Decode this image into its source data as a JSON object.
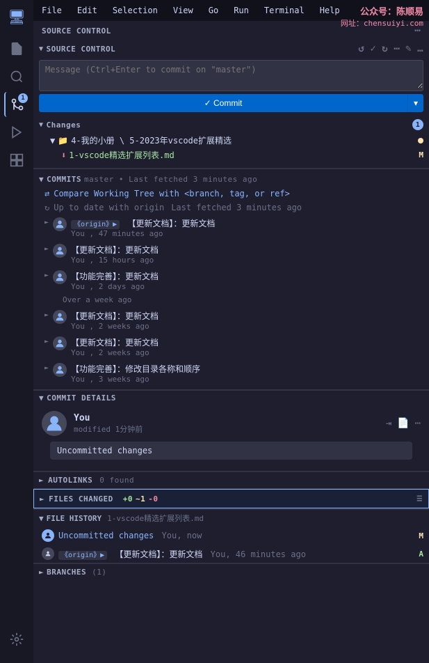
{
  "titlebar": {
    "menu_items": [
      "File",
      "Edit",
      "Selection",
      "View",
      "Go",
      "Run",
      "Terminal",
      "Help"
    ]
  },
  "watermark": {
    "line1": "公众号：陈顺易",
    "line2": "网址：chensuiyi.com"
  },
  "activity_bar": {
    "icons": [
      {
        "name": "explorer-icon",
        "symbol": "📄",
        "active": false
      },
      {
        "name": "search-icon",
        "symbol": "🔍",
        "active": false
      },
      {
        "name": "source-control-icon",
        "symbol": "⎇",
        "active": true,
        "badge": "1"
      },
      {
        "name": "run-icon",
        "symbol": "▶",
        "active": false
      },
      {
        "name": "extensions-icon",
        "symbol": "⊞",
        "active": false
      },
      {
        "name": "git-icon",
        "symbol": "🌿",
        "active": false
      }
    ]
  },
  "source_control": {
    "panel_header": "SOURCE CONTROL",
    "section_title": "SOURCE CONTROL",
    "message_placeholder": "Message (Ctrl+Enter to commit on \"master\")",
    "commit_button": "✓ Commit",
    "commit_dropdown_label": "▾",
    "changes": {
      "label": "Changes",
      "badge": "1",
      "folder": "4-我的小册 \\ 5-2023年vscode扩展精选",
      "file": "1-vscode精选扩展列表.md",
      "file_badge": "M"
    },
    "commits": {
      "header": "COMMITS",
      "subtitle": "master • Last fetched 3 minutes ago",
      "compare_action": "Compare Working Tree with <branch, tag, or ref>",
      "up_to_date": "Up to date with origin",
      "up_to_date_meta": "Last fetched 3 minutes ago",
      "items": [
        {
          "origin_tag": "《origin》▶",
          "message": "【更新文档】：更新文档",
          "author": "You",
          "time": "47 minutes ago",
          "has_origin": true
        },
        {
          "message": "【更新文档】：更新文档",
          "author": "You",
          "time": "15 hours ago",
          "has_origin": false
        },
        {
          "message": "【功能完善】：更新文档",
          "author": "You",
          "time": "2 days ago",
          "extra_time": "Over a week ago",
          "has_origin": false
        },
        {
          "message": "【更新文档】：更新文档",
          "author": "You",
          "time": "2 weeks ago",
          "has_origin": false
        },
        {
          "message": "【更新文档】：更新文档",
          "author": "You",
          "time": "2 weeks ago",
          "has_origin": false
        },
        {
          "message": "【功能完善】：修改目录各称和顺序",
          "author": "You",
          "time": "3 weeks ago",
          "has_origin": false
        }
      ]
    },
    "commit_details": {
      "header": "COMMIT DETAILS",
      "author_name": "You",
      "author_time": "modified 1分钟前",
      "uncommitted_label": "Uncommitted changes"
    },
    "autolinks": {
      "header": "AUTOLINKS",
      "count": "0 found"
    },
    "files_changed": {
      "header": "FILES CHANGED",
      "add": "+0",
      "mod": "~1",
      "del": "-0"
    },
    "file_history": {
      "header": "FILE HISTORY",
      "filename": "1-vscode精选扩展列表.md",
      "items": [
        {
          "icon_type": "user",
          "message": "Uncommitted changes",
          "author": "You",
          "time": "now",
          "badge": "M"
        },
        {
          "icon_type": "origin",
          "origin_tag": "《origin》▶",
          "message": "【更新文档】：更新文档",
          "author": "You",
          "time": "46 minutes ago",
          "badge": "A"
        }
      ]
    },
    "branches": {
      "header": "BRANCHES",
      "count": "(1)"
    }
  }
}
